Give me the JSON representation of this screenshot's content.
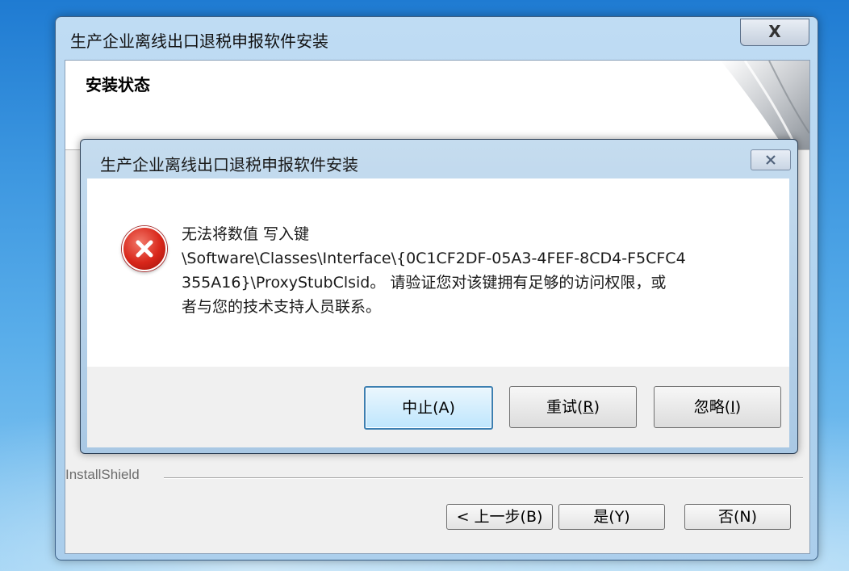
{
  "outer_window": {
    "title": "生产企业离线出口退税申报软件安装",
    "close_label": "X",
    "header_title": "安装状态",
    "installshield_label": "InstallShield",
    "buttons": {
      "back": "< 上一步(B)",
      "yes": "是(Y)",
      "no": "否(N)"
    }
  },
  "dialog": {
    "title": "生产企业离线出口退税申报软件安装",
    "close_label": "X",
    "message_lines": [
      "无法将数值 写入键",
      "\\Software\\Classes\\Interface\\{0C1CF2DF-05A3-4FEF-8CD4-F5CFC4",
      "355A16}\\ProxyStubClsid。 请验证您对该键拥有足够的访问权限，或",
      "者与您的技术支持人员联系。"
    ],
    "buttons": {
      "abort": "中止(A)",
      "retry_prefix": "重试(",
      "retry_key": "R",
      "retry_suffix": ")",
      "ignore_prefix": "忽略(",
      "ignore_key": "I",
      "ignore_suffix": ")"
    },
    "icon": "error-icon"
  },
  "colors": {
    "desktop": "#3d97e0",
    "error_red": "#d8261a",
    "focus_border": "#3c7fb1"
  }
}
